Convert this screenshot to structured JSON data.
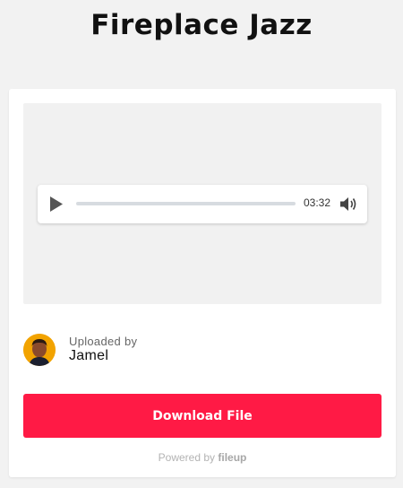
{
  "page": {
    "title": "Fireplace Jazz"
  },
  "player": {
    "time": "03:32",
    "progress": 0,
    "icons": {
      "play": "play-icon",
      "volume": "volume-icon"
    }
  },
  "uploader": {
    "label": "Uploaded by",
    "name": "Jamel",
    "avatar_color": "#f2a300"
  },
  "download": {
    "label": "Download File",
    "color": "#ff1a45"
  },
  "footer": {
    "powered_label": "Powered by",
    "brand": "fileup"
  }
}
